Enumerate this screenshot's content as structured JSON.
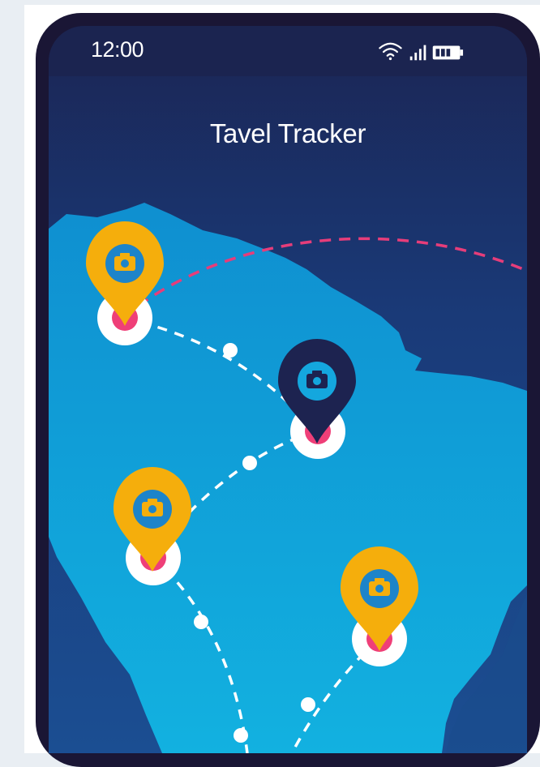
{
  "status_bar": {
    "time": "12:00",
    "icons": [
      "wifi-icon",
      "signal-icon",
      "battery-icon"
    ]
  },
  "app": {
    "title": "Tavel Tracker"
  },
  "map": {
    "pins": [
      {
        "name": "pin-1",
        "color": "#f5ae0c",
        "icon": "camera-icon"
      },
      {
        "name": "pin-2",
        "color": "#1d2350",
        "icon": "camera-icon"
      },
      {
        "name": "pin-3",
        "color": "#f5ae0c",
        "icon": "camera-icon"
      },
      {
        "name": "pin-4",
        "color": "#f5ae0c",
        "icon": "camera-icon"
      }
    ],
    "colors": {
      "land": "#11a9dc",
      "ocean": "#1b3a7a",
      "route": "#ffffff",
      "flight_route": "#e63d7a",
      "marker_dot": "#ef3f78"
    }
  }
}
